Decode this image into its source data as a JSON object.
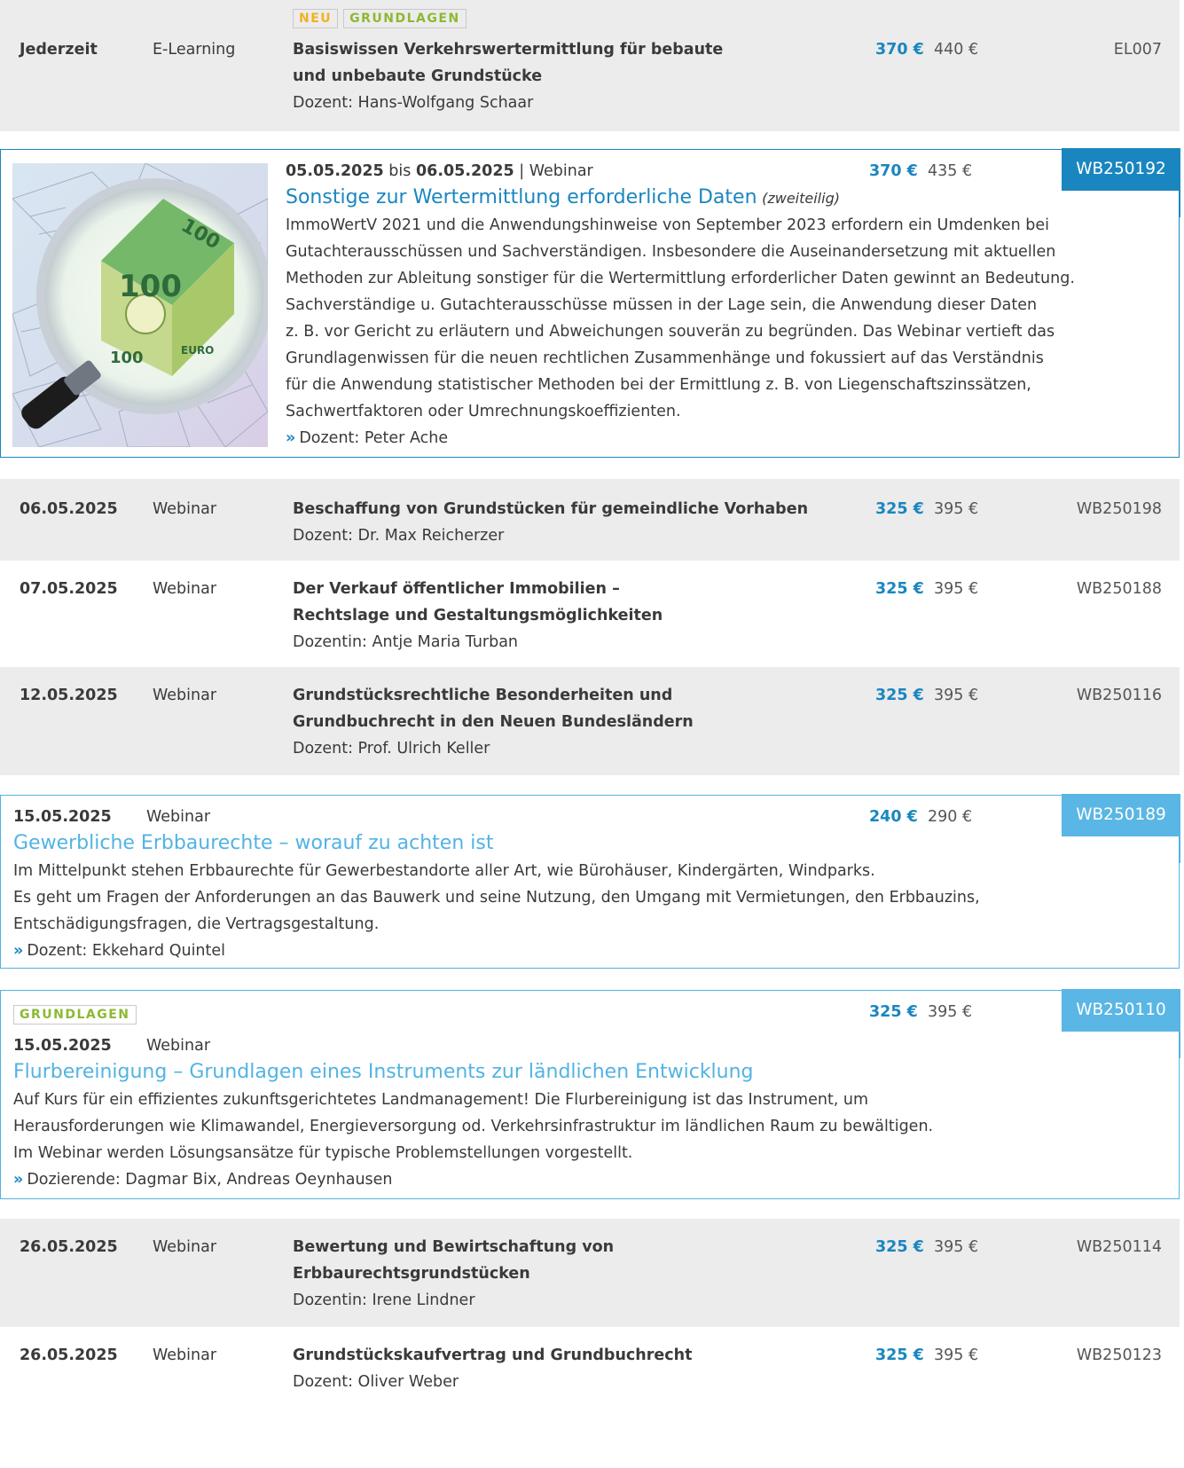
{
  "rows": [
    {
      "tags": [
        "NEU",
        "GRUNDLAGEN"
      ],
      "date": "Jederzeit",
      "type": "E-Learning",
      "title_line1": "Basiswissen Verkehrswertermittlung für bebaute",
      "title_line2": "und unbebaute Grundstücke",
      "lecturer": "Dozent: Hans-Wolfgang Schaar",
      "price": "370 €",
      "price_old": "440 €",
      "code": "EL007"
    },
    {
      "date_from": "05.05.2025",
      "date_sep": "bis",
      "date_to": "06.05.2025",
      "type": "| Webinar",
      "title": "Sonstige zur Wertermittlung erforderliche Daten",
      "title_note": "(zweiteilig)",
      "desc": [
        "ImmoWertV 2021 und die Anwendungshinweise von September 2023 erfordern ein Umdenken bei",
        "Gutachterausschüssen und Sachverständigen. Insbesondere die Auseinandersetzung mit aktuellen",
        "Methoden zur Ableitung sonstiger für die Wertermittlung erforderlicher Daten gewinnt an Bedeutung.",
        "Sachverständige u. Gutachterausschüsse müssen in der Lage sein, die Anwendung dieser Daten",
        "z. B. vor Gericht zu erläutern und Abweichungen souverän zu begründen. Das Webinar vertieft das",
        "Grundlagenwissen für die neuen rechtlichen Zusammenhänge und fokussiert auf das Verständnis",
        "für die Anwendung statistischer Methoden bei der Ermittlung z. B. von Liegenschaftszinssätzen,",
        "Sachwertfaktoren oder Umrechnungskoeffizienten."
      ],
      "lecturer": "Dozent: Peter Ache",
      "price": "370 €",
      "price_old": "435 €",
      "code": "WB250192"
    },
    {
      "date": "06.05.2025",
      "type": "Webinar",
      "title_line1": "Beschaffung von Grundstücken für gemeindliche Vorhaben",
      "lecturer": "Dozent: Dr. Max Reicherzer",
      "price": "325 €",
      "price_old": "395 €",
      "code": "WB250198"
    },
    {
      "date": "07.05.2025",
      "type": "Webinar",
      "title_line1": "Der Verkauf öffentlicher Immobilien –",
      "title_line2": "Rechtslage und Gestaltungsmöglichkeiten",
      "lecturer": "Dozentin: Antje Maria Turban",
      "price": "325 €",
      "price_old": "395 €",
      "code": "WB250188"
    },
    {
      "date": "12.05.2025",
      "type": "Webinar",
      "title_line1": "Grundstücksrechtliche Besonderheiten und",
      "title_line2": "Grundbuchrecht in den Neuen Bundesländern",
      "lecturer": "Dozent: Prof. Ulrich Keller",
      "price": "325 €",
      "price_old": "395 €",
      "code": "WB250116"
    },
    {
      "date": "15.05.2025",
      "type": "Webinar",
      "title": "Gewerbliche Erbbaurechte – worauf zu achten ist",
      "desc": [
        "Im Mittelpunkt stehen Erbbaurechte für Gewerbestandorte aller Art, wie Bürohäuser, Kindergärten, Windparks.",
        "Es geht um Fragen der Anforderungen an das Bauwerk und seine Nutzung, den Umgang mit Vermietungen, den Erbbauzins,",
        "Entschädigungsfragen, die Vertragsgestaltung."
      ],
      "lecturer": "Dozent: Ekkehard Quintel",
      "price": "240 €",
      "price_old": "290 €",
      "code": "WB250189"
    },
    {
      "tags": [
        "GRUNDLAGEN"
      ],
      "date": "15.05.2025",
      "type": "Webinar",
      "title": "Flurbereinigung – Grundlagen eines Instruments zur ländlichen Entwicklung",
      "desc": [
        "Auf Kurs für ein effizientes zukunftsgerichtetes Landmanagement! Die Flurbereinigung ist das Instrument, um",
        "Herausforderungen wie Klimawandel, Energieversorgung od. Verkehrsinfrastruktur im ländlichen Raum zu bewältigen.",
        "Im Webinar werden Lösungsansätze für typische Problemstellungen vorgestellt."
      ],
      "lecturer": "Dozierende: Dagmar Bix, Andreas Oeynhausen",
      "price": "325 €",
      "price_old": "395 €",
      "code": "WB250110"
    },
    {
      "date": "26.05.2025",
      "type": "Webinar",
      "title_line1": "Bewertung und Bewirtschaftung von",
      "title_line2": "Erbbaurechtsgrundstücken",
      "lecturer": "Dozentin: Irene Lindner",
      "price": "325 €",
      "price_old": "395 €",
      "code": "WB250114"
    },
    {
      "date": "26.05.2025",
      "type": "Webinar",
      "title_line1": "Grundstückskaufvertrag und Grundbuchrecht",
      "lecturer": "Dozent: Oliver Weber",
      "price": "325 €",
      "price_old": "395 €",
      "code": "WB250123"
    }
  ],
  "arrow_glyph": "»",
  "colors": {
    "accent": "#1a86bf",
    "accent_light": "#52b3e3",
    "tag_new": "#f2b11f",
    "tag_basic": "#8db832",
    "row_grey": "#ececec"
  },
  "image_icon": "magnifier-euro-house-image"
}
